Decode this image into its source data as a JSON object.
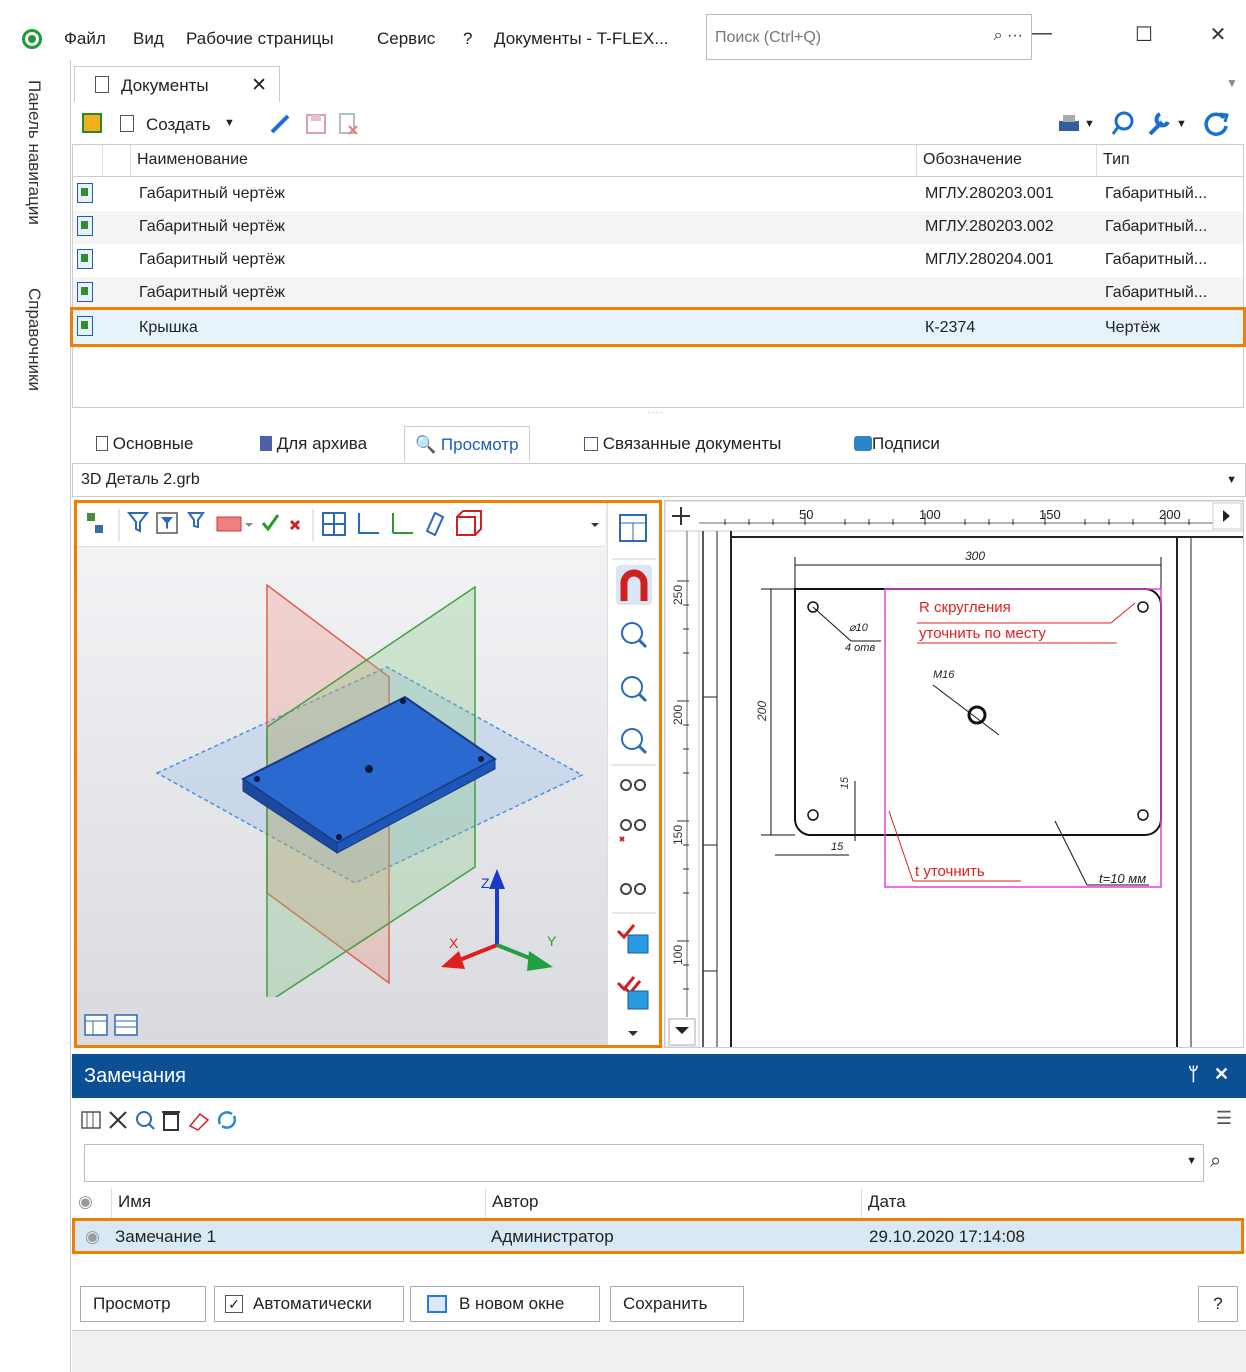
{
  "titlebar": {
    "menu": [
      "Файл",
      "Вид",
      "Рабочие страницы",
      "Сервис",
      "?",
      "Документы - T-FLEX..."
    ],
    "search_placeholder": "Поиск (Ctrl+Q)",
    "search_more": "⌕ ···",
    "min": "—",
    "max": "☐",
    "close": "✕"
  },
  "sidebar": {
    "nav_panel": "Панель навигации",
    "references": "Справочники"
  },
  "doc_tab": {
    "label": "Документы",
    "close": "✕"
  },
  "toolbar": {
    "create": "Создать"
  },
  "grid": {
    "columns": [
      "Наименование",
      "Обозначение",
      "Тип"
    ],
    "rows": [
      {
        "name": "Габаритный чертёж",
        "code": "МГЛУ.280203.001",
        "type": "Габаритный..."
      },
      {
        "name": "Габаритный чертёж",
        "code": "МГЛУ.280203.002",
        "type": "Габаритный..."
      },
      {
        "name": "Габаритный чертёж",
        "code": "МГЛУ.280204.001",
        "type": "Габаритный..."
      },
      {
        "name": "Габаритный чертёж",
        "code": "",
        "type": "Габаритный..."
      },
      {
        "name": "Крышка",
        "code": "К-2374",
        "type": "Чертёж"
      }
    ]
  },
  "tabs": [
    "Основные",
    "Для архива",
    "Просмотр",
    "Связанные документы",
    "Подписи"
  ],
  "file": {
    "name": "3D Деталь 2.grb"
  },
  "drawing": {
    "ruler_x": [
      "50",
      "100",
      "150",
      "200"
    ],
    "ruler_y": [
      "250",
      "200",
      "150",
      "100"
    ],
    "dim_300": "300",
    "dim_200": "200",
    "dim_15a": "15",
    "dim_15b": "15",
    "hole": "⌀10",
    "hole_count": "4 отв",
    "m16": "M16",
    "note1": "R скругления",
    "note2": "уточнить по месту",
    "note3": "t уточнить",
    "thickness": "t=10 мм"
  },
  "axes": {
    "x": "X",
    "y": "Y",
    "z": "Z"
  },
  "remarks": {
    "title": "Замечания",
    "pin": "ᛘ",
    "close": "✕",
    "columns": [
      "Имя",
      "Автор",
      "Дата"
    ],
    "row": {
      "name": "Замечание 1",
      "author": "Администратор",
      "date": "29.10.2020 17:14:08"
    },
    "buttons": {
      "view": "Просмотр",
      "auto": "Автоматически",
      "new_window": "В новом окне",
      "save": "Сохранить",
      "help": "?"
    }
  }
}
